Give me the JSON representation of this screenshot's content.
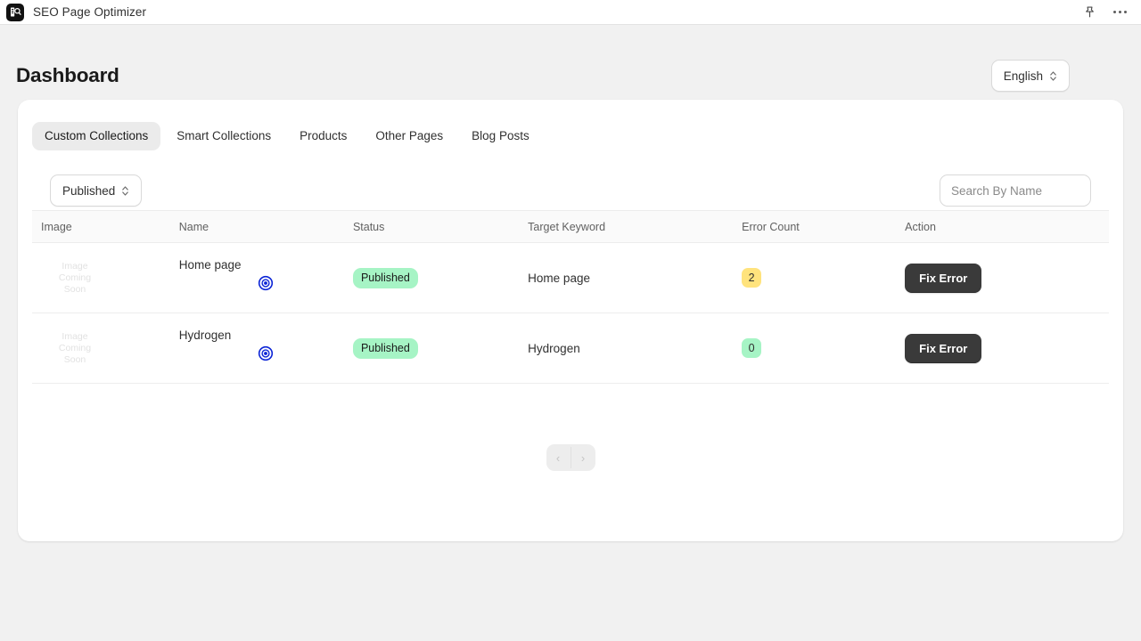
{
  "topbar": {
    "app_title": "SEO Page Optimizer",
    "app_icon": "app-logo-icon",
    "pin_icon": "pin-icon",
    "more_icon": "more-horizontal-icon"
  },
  "header": {
    "title": "Dashboard",
    "language": {
      "value": "English",
      "icon": "chevron-up-down-icon"
    }
  },
  "tabs": [
    {
      "label": "Custom Collections",
      "active": true
    },
    {
      "label": "Smart Collections",
      "active": false
    },
    {
      "label": "Products",
      "active": false
    },
    {
      "label": "Other Pages",
      "active": false
    },
    {
      "label": "Blog Posts",
      "active": false
    }
  ],
  "filters": {
    "status": {
      "value": "Published",
      "icon": "chevron-up-down-icon"
    },
    "search": {
      "value": "",
      "placeholder": "Search By Name"
    }
  },
  "table": {
    "columns": [
      "Image",
      "Name",
      "Status",
      "Target Keyword",
      "Error Count",
      "Action"
    ],
    "image_placeholder": [
      "Image",
      "Coming",
      "Soon"
    ],
    "rows": [
      {
        "name": "Home page",
        "view_icon": "eye-view-icon",
        "status": "Published",
        "target_keyword": "Home page",
        "error_count": "2",
        "error_tone": "warn",
        "action_label": "Fix Error"
      },
      {
        "name": "Hydrogen",
        "view_icon": "eye-view-icon",
        "status": "Published",
        "target_keyword": "Hydrogen",
        "error_count": "0",
        "error_tone": "ok",
        "action_label": "Fix Error"
      }
    ]
  },
  "pagination": {
    "prev_icon": "chevron-left-icon",
    "prev_label": "‹",
    "next_icon": "chevron-right-icon",
    "next_label": "›"
  },
  "colors": {
    "page_bg": "#f1f1f1",
    "card_bg": "#ffffff",
    "accent_dark": "#3a3a3a",
    "badge_green": "#a6f4c5",
    "badge_yellow": "#ffe37d",
    "eye_blue": "#0b24d6"
  }
}
